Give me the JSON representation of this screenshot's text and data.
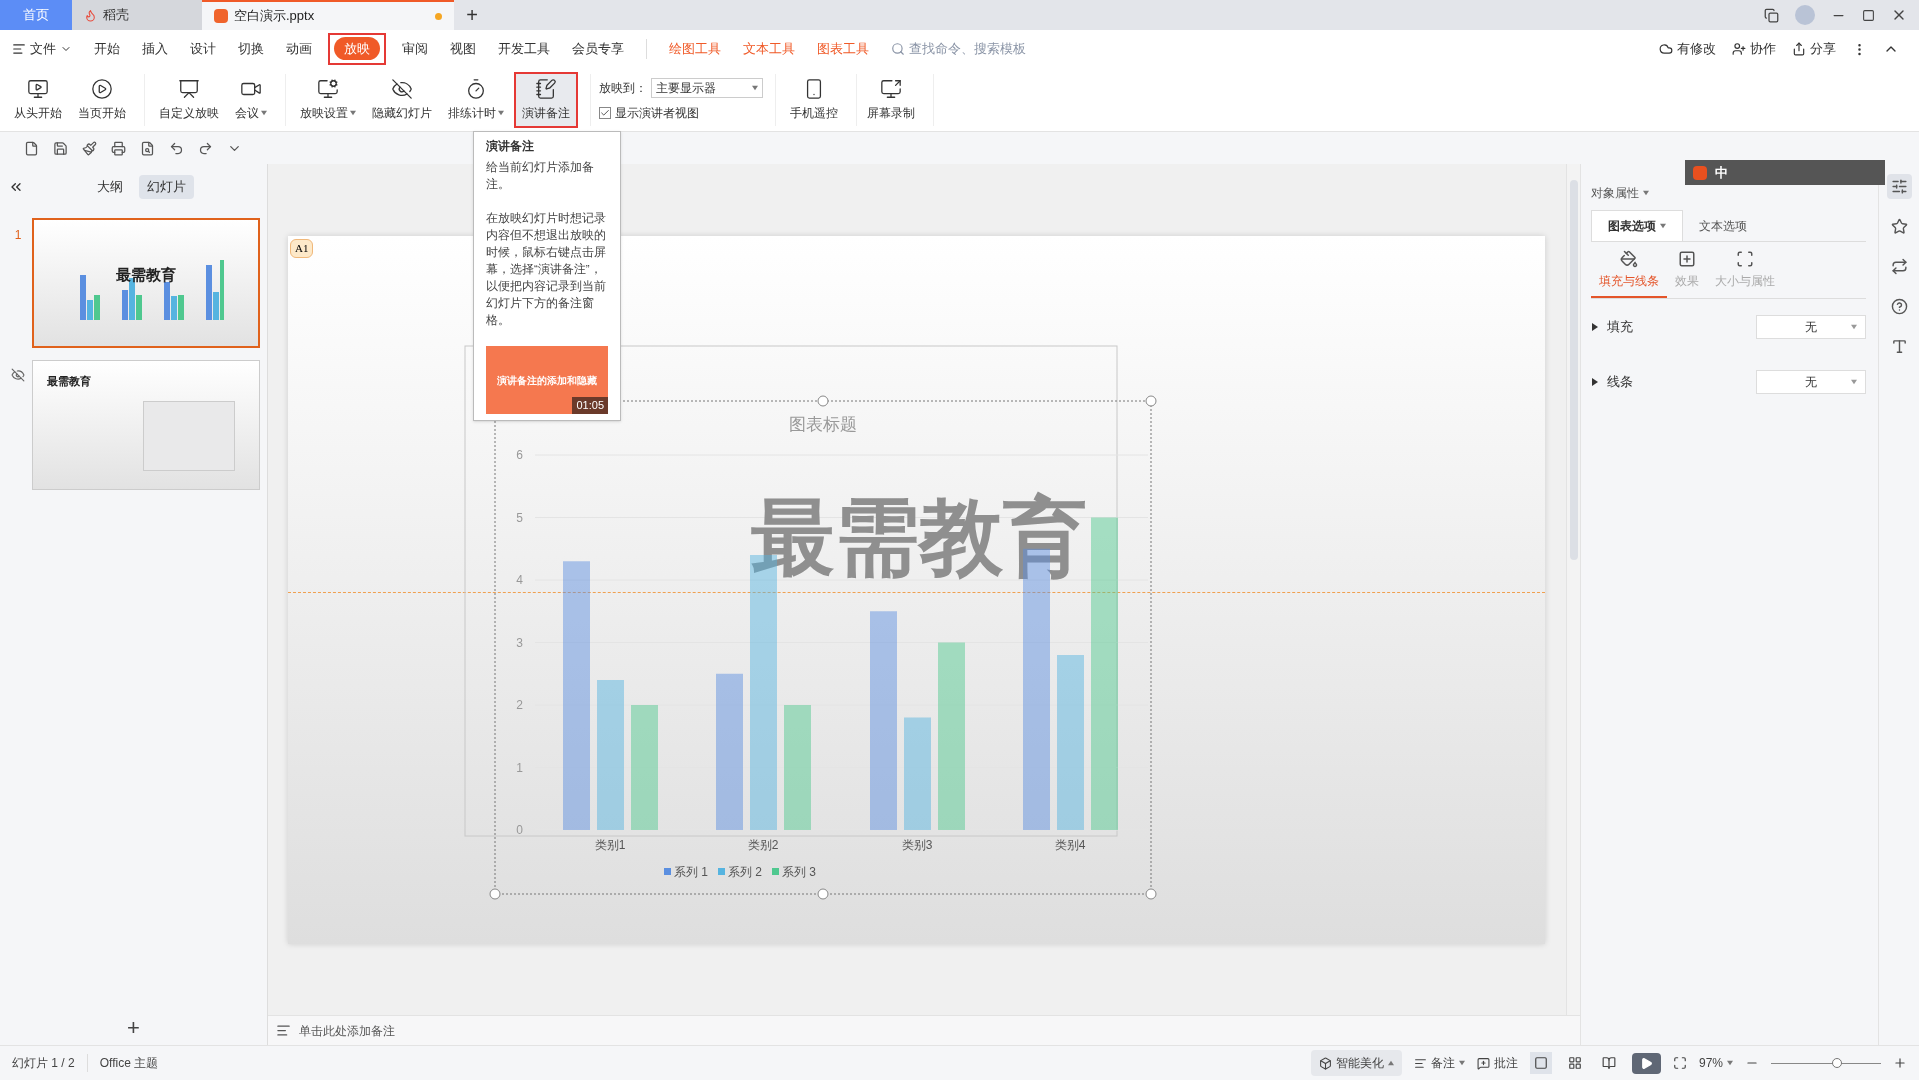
{
  "title_bar": {
    "tabs": [
      {
        "label": "首页",
        "kind": "home",
        "selected": false
      },
      {
        "label": "稻壳",
        "kind": "docer",
        "selected": false
      },
      {
        "label": "空白演示.pptx",
        "kind": "document",
        "selected": true,
        "unsaved": true
      }
    ],
    "new_tab": "+"
  },
  "menu": {
    "file": "文件",
    "items": [
      {
        "label": "开始",
        "selected": false,
        "annotated": false
      },
      {
        "label": "插入",
        "selected": false,
        "annotated": false
      },
      {
        "label": "设计",
        "selected": false,
        "annotated": false
      },
      {
        "label": "切换",
        "selected": false,
        "annotated": false
      },
      {
        "label": "动画",
        "selected": false,
        "annotated": false
      },
      {
        "label": "放映",
        "selected": true,
        "annotated": true
      },
      {
        "label": "审阅",
        "selected": false,
        "annotated": false
      },
      {
        "label": "视图",
        "selected": false,
        "annotated": false
      },
      {
        "label": "开发工具",
        "selected": false,
        "annotated": false
      },
      {
        "label": "会员专享",
        "selected": false,
        "annotated": false
      }
    ],
    "tool_tabs": [
      "绘图工具",
      "文本工具",
      "图表工具"
    ],
    "search": {
      "placeholder": "查找命令、搜索模板"
    },
    "actions": [
      "有修改",
      "协作",
      "分享"
    ]
  },
  "ribbon": {
    "groups": [
      {
        "buttons": [
          {
            "label": "从头开始",
            "dropdown": false,
            "annotated": false
          },
          {
            "label": "当页开始",
            "dropdown": false,
            "annotated": false
          }
        ]
      },
      {
        "buttons": [
          {
            "label": "自定义放映",
            "dropdown": false,
            "annotated": false
          },
          {
            "label": "会议",
            "dropdown": true,
            "annotated": false
          }
        ]
      },
      {
        "buttons": [
          {
            "label": "放映设置",
            "dropdown": true,
            "annotated": false
          },
          {
            "label": "隐藏幻灯片",
            "dropdown": false,
            "annotated": false
          },
          {
            "label": "排练计时",
            "dropdown": true,
            "annotated": false
          },
          {
            "label": "演讲备注",
            "dropdown": false,
            "annotated": true
          }
        ]
      }
    ],
    "show_to": {
      "label": "放映到：",
      "value": "主要显示器"
    },
    "presenter_view": {
      "label": "显示演讲者视图",
      "checked": true
    },
    "extra_buttons": [
      {
        "label": "手机遥控"
      },
      {
        "label": "屏幕录制"
      }
    ]
  },
  "tooltip": {
    "title": "演讲备注",
    "paragraphs": [
      "给当前幻灯片添加备注。",
      "在放映幻灯片时想记录内容但不想退出放映的时候，鼠标右键点击屏幕，选择“演讲备注”，以便把内容记录到当前幻灯片下方的备注窗格。"
    ],
    "video": {
      "title": "演讲备注的添加和隐藏",
      "duration": "01:05"
    }
  },
  "left_panel": {
    "tabs": [
      {
        "label": "大纲",
        "selected": false
      },
      {
        "label": "幻灯片",
        "selected": true
      }
    ],
    "slides": [
      {
        "number": "1",
        "selected": true,
        "hidden": false,
        "kind": "chart",
        "title": "最需教育"
      },
      {
        "selected": false,
        "hidden": true,
        "kind": "text",
        "title": "最需教育"
      }
    ],
    "add": "+"
  },
  "slide": {
    "badge": "A1",
    "title": "最需教育",
    "chart_data": {
      "type": "bar",
      "title": "图表标题",
      "categories": [
        "类别1",
        "类别2",
        "类别3",
        "类别4"
      ],
      "series": [
        {
          "name": "系列 1",
          "color": "#5b8fe0",
          "values": [
            4.3,
            2.5,
            3.5,
            4.5
          ]
        },
        {
          "name": "系列 2",
          "color": "#56b4e0",
          "values": [
            2.4,
            4.4,
            1.8,
            2.8
          ]
        },
        {
          "name": "系列 3",
          "color": "#4fc88f",
          "values": [
            2,
            2,
            3,
            5
          ]
        }
      ],
      "ylim": [
        0,
        6
      ],
      "yticks": [
        {
          "value": 0,
          "label": "0"
        },
        {
          "value": 1,
          "label": "1"
        },
        {
          "value": 2,
          "label": "2"
        },
        {
          "value": 3,
          "label": "3"
        },
        {
          "value": 4,
          "label": "4"
        },
        {
          "value": 5,
          "label": "5"
        },
        {
          "value": 6,
          "label": "6"
        }
      ],
      "grid": true,
      "legend": true
    }
  },
  "notes": {
    "placeholder": "单击此处添加备注"
  },
  "ime_bar": {
    "mode": "中"
  },
  "right_panel": {
    "title": "对象属性",
    "tabs": [
      {
        "label": "图表选项",
        "selected": true
      },
      {
        "label": "文本选项",
        "selected": false
      }
    ],
    "subtabs": [
      {
        "label": "填充与线条",
        "selected": true
      },
      {
        "label": "效果",
        "selected": false
      },
      {
        "label": "大小与属性",
        "selected": false
      }
    ],
    "properties": [
      {
        "label": "填充",
        "value": "无",
        "expanded": false
      },
      {
        "label": "线条",
        "value": "无",
        "expanded": false
      }
    ]
  },
  "status_bar": {
    "slide": "幻灯片 1 / 2",
    "theme": "Office 主题",
    "beautify": "智能美化",
    "notes": "备注",
    "comments": "批注",
    "views": [
      {
        "selected": true
      },
      {
        "selected": false
      },
      {
        "selected": false
      }
    ],
    "zoom": "97%",
    "zoom_slider": {
      "level": 0.6
    }
  }
}
